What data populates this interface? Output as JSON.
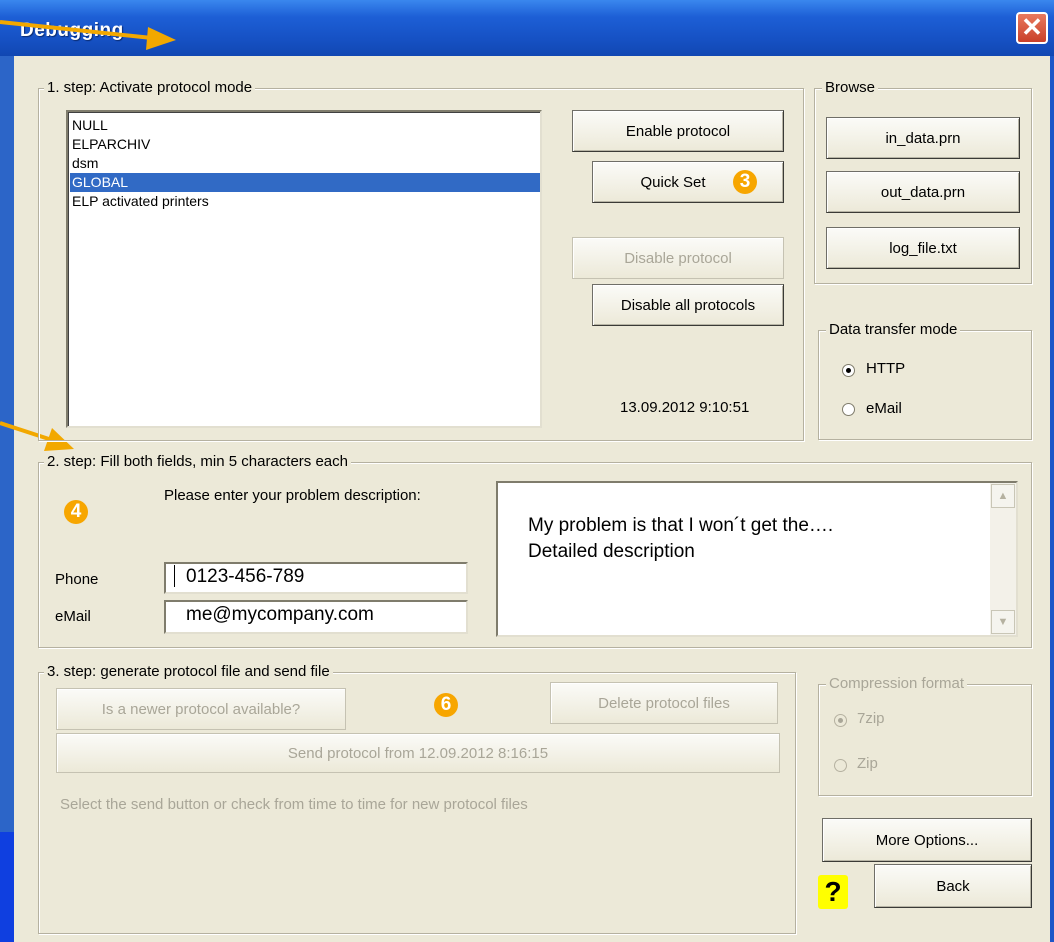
{
  "window": {
    "title": "Debugging",
    "close_icon": "close-icon"
  },
  "step1": {
    "legend": "1. step: Activate protocol mode",
    "list_items": [
      "NULL",
      "ELPARCHIV",
      "dsm",
      "GLOBAL",
      "ELP activated printers"
    ],
    "selected_item": "GLOBAL",
    "enable_button": "Enable protocol",
    "quick_set_button": "Quick Set",
    "disable_button": "Disable protocol",
    "disable_all_button": "Disable all protocols",
    "timestamp": "13.09.2012  9:10:51"
  },
  "browse": {
    "legend": "Browse",
    "in_data_button": "in_data.prn",
    "out_data_button": "out_data.prn",
    "log_file_button": "log_file.txt"
  },
  "transfer": {
    "legend": "Data transfer mode",
    "options": [
      {
        "label": "HTTP",
        "checked": true
      },
      {
        "label": "eMail",
        "checked": false
      }
    ]
  },
  "step2": {
    "legend": "2. step: Fill both fields, min 5 characters each",
    "problem_label": "Please enter your problem description:",
    "phone_label": "Phone",
    "phone_value": "0123-456-789",
    "email_label": "eMail",
    "email_value": "me@mycompany.com",
    "description_lines": [
      "My problem is that I won´t get the….",
      "Detailed description"
    ]
  },
  "step3": {
    "legend": "3. step: generate protocol file and send file",
    "newer_button": "Is a newer protocol available?",
    "delete_button": "Delete protocol files",
    "send_button": "Send protocol from 12.09.2012  8:16:15",
    "hint": "Select the send button or check from time to time for new protocol files"
  },
  "compression": {
    "legend": "Compression format",
    "options": [
      {
        "label": "7zip",
        "checked": true
      },
      {
        "label": "Zip",
        "checked": false
      }
    ]
  },
  "footer": {
    "more_options_button": "More Options...",
    "back_button": "Back",
    "help_glyph": "?"
  },
  "badges": {
    "quick_set": "3",
    "step2": "4",
    "step3": "6"
  },
  "colors": {
    "accent_badge": "#f7a600",
    "selection": "#316ac5",
    "title_bar": "#1d5fd6"
  }
}
